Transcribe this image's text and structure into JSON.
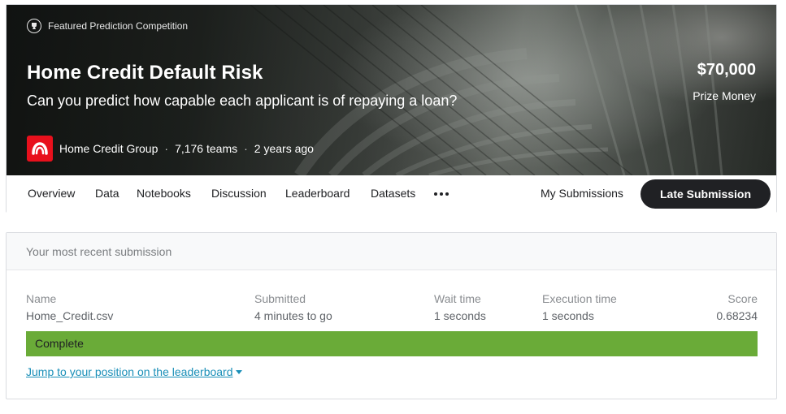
{
  "banner": {
    "featured_label": "Featured Prediction Competition",
    "title": "Home Credit Default Risk",
    "subtitle": "Can you predict how capable each applicant is of repaying a loan?",
    "prize_amount": "$70,000",
    "prize_label": "Prize Money",
    "host": "Home Credit Group",
    "teams": "7,176 teams",
    "age": "2 years ago",
    "host_logo_color": "#e8101c"
  },
  "tabs": {
    "items": [
      "Overview",
      "Data",
      "Notebooks",
      "Discussion",
      "Leaderboard",
      "Datasets"
    ],
    "more_icon": "more-horizontal-icon",
    "my_submissions": "My Submissions",
    "late_submission": "Late Submission"
  },
  "submission": {
    "header": "Your most recent submission",
    "columns": {
      "name": {
        "label": "Name",
        "value": "Home_Credit.csv"
      },
      "submitted": {
        "label": "Submitted",
        "value": "4 minutes to go"
      },
      "wait": {
        "label": "Wait time",
        "value": "1 seconds"
      },
      "execution": {
        "label": "Execution time",
        "value": "1 seconds"
      },
      "score": {
        "label": "Score",
        "value": "0.68234"
      }
    },
    "status": "Complete",
    "status_color": "#6aab38",
    "jump_link": "Jump to your position on the leaderboard"
  }
}
